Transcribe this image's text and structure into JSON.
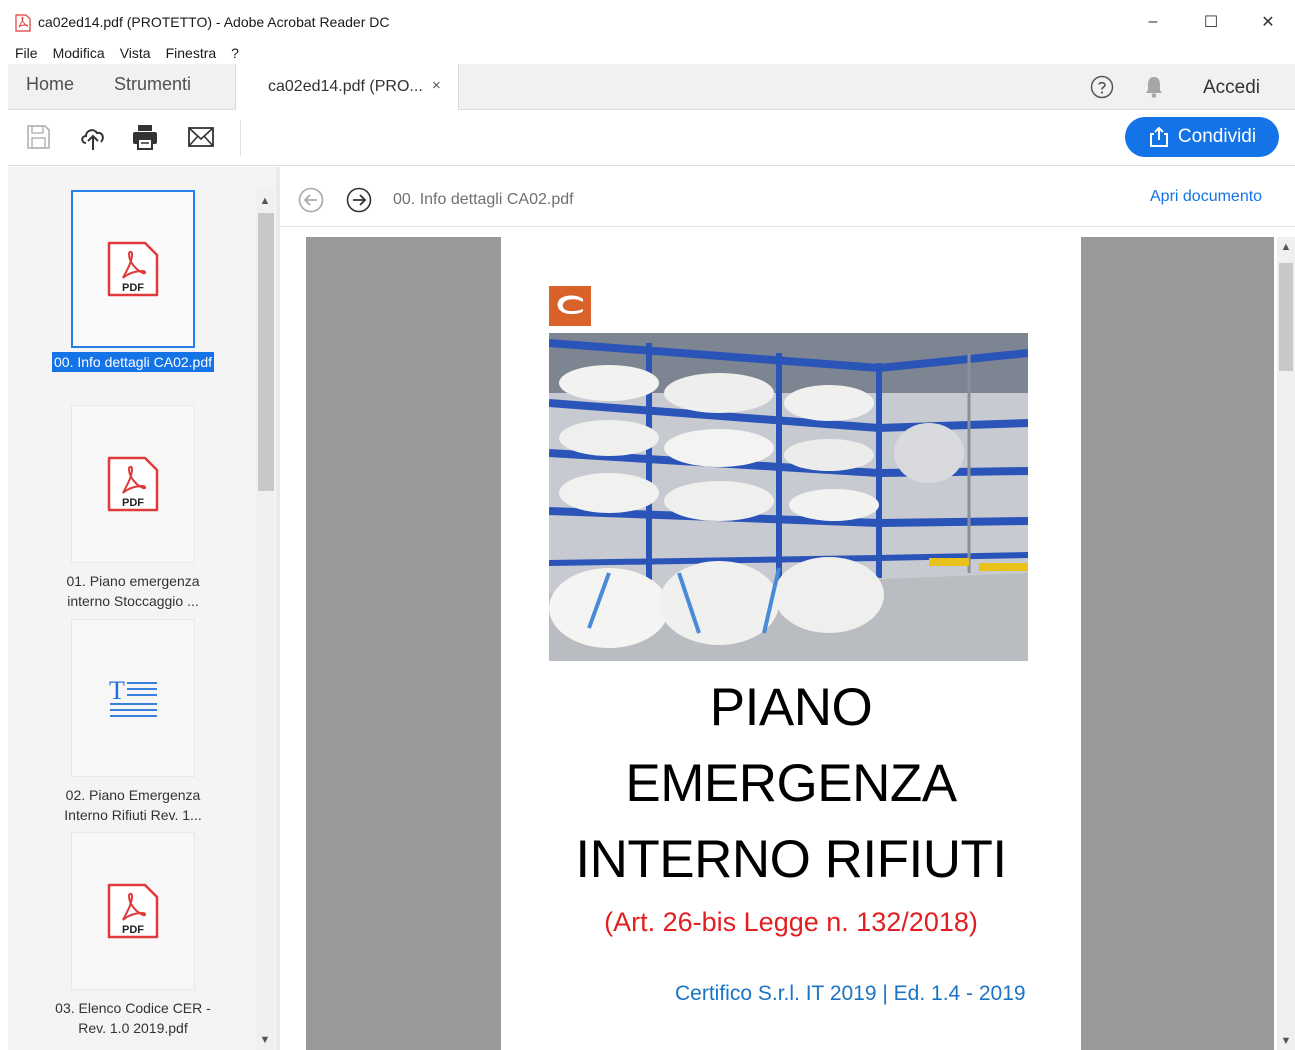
{
  "window": {
    "title": "ca02ed14.pdf (PROTETTO) - Adobe Acrobat Reader DC",
    "minimize": "–",
    "maximize": "☐",
    "close": "✕"
  },
  "menu": [
    "File",
    "Modifica",
    "Vista",
    "Finestra",
    "?"
  ],
  "tabs": {
    "home": "Home",
    "tools": "Strumenti",
    "document": "ca02ed14.pdf (PRO...",
    "close": "×"
  },
  "header_right": {
    "signin": "Accedi"
  },
  "toolbar": {
    "share_label": "Condividi"
  },
  "files": [
    {
      "label": "00. Info dettagli CA02.pdf",
      "type": "pdf",
      "selected": true
    },
    {
      "label_line1": "01. Piano emergenza",
      "label_line2": "interno Stoccaggio ...",
      "type": "pdf"
    },
    {
      "label_line1": "02. Piano Emergenza",
      "label_line2": "Interno Rifiuti Rev. 1...",
      "type": "text"
    },
    {
      "label_line1": "03. Elenco Codice CER -",
      "label_line2": "Rev. 1.0 2019.pdf",
      "type": "pdf"
    }
  ],
  "pdf_badge": "PDF",
  "document": {
    "path": "00. Info dettagli CA02.pdf",
    "open_label": "Apri documento",
    "title_line1": "PIANO",
    "title_line2": "EMERGENZA",
    "title_line3": "INTERNO RIFIUTI",
    "subtitle": "(Art. 26-bis Legge n. 132/2018)",
    "footer": "Certifico S.r.l. IT 2019 | Ed. 1.4 - 2019"
  },
  "colors": {
    "accent": "#1473e6",
    "pdf_red": "#e03a3a",
    "logo": "#d9622b",
    "subtitle_red": "#e02020",
    "footer_blue": "#1a73c4"
  },
  "icons": [
    "pdf-app-icon",
    "save-icon",
    "cloud-upload-icon",
    "print-icon",
    "mail-icon",
    "share-icon",
    "help-icon",
    "bell-icon",
    "back-arrow-icon",
    "forward-arrow-icon"
  ]
}
